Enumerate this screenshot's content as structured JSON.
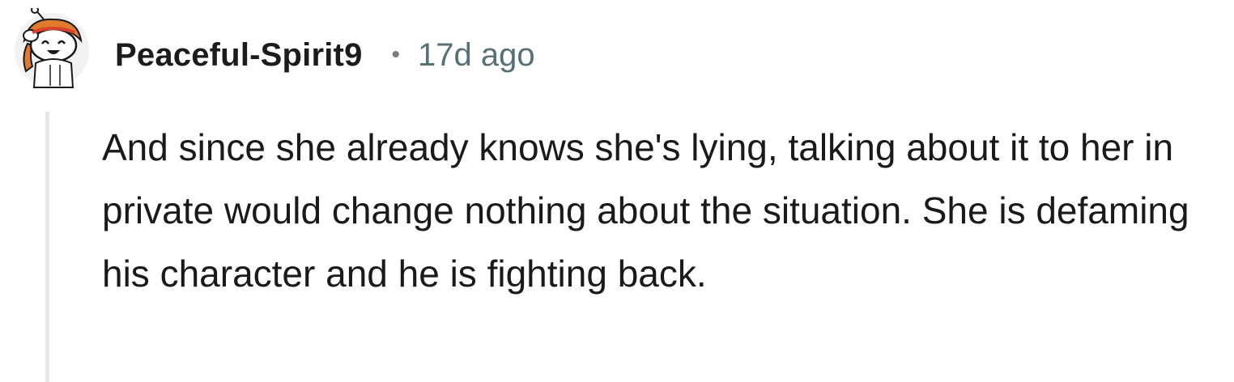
{
  "comment": {
    "username": "Peaceful-Spirit9",
    "separator": "•",
    "timestamp": "17d ago",
    "body": "And since she already knows she's lying, talking about it to her in private would change nothing about the situation. She is defaming his character and he is fighting back."
  },
  "icons": {
    "avatar": "snoo-avatar-icon"
  },
  "colors": {
    "background": "#ffffff",
    "username": "#1c1c1c",
    "timestamp": "#576f76",
    "body_text": "#1a1a1b",
    "thread_line": "#e6e6e6"
  }
}
